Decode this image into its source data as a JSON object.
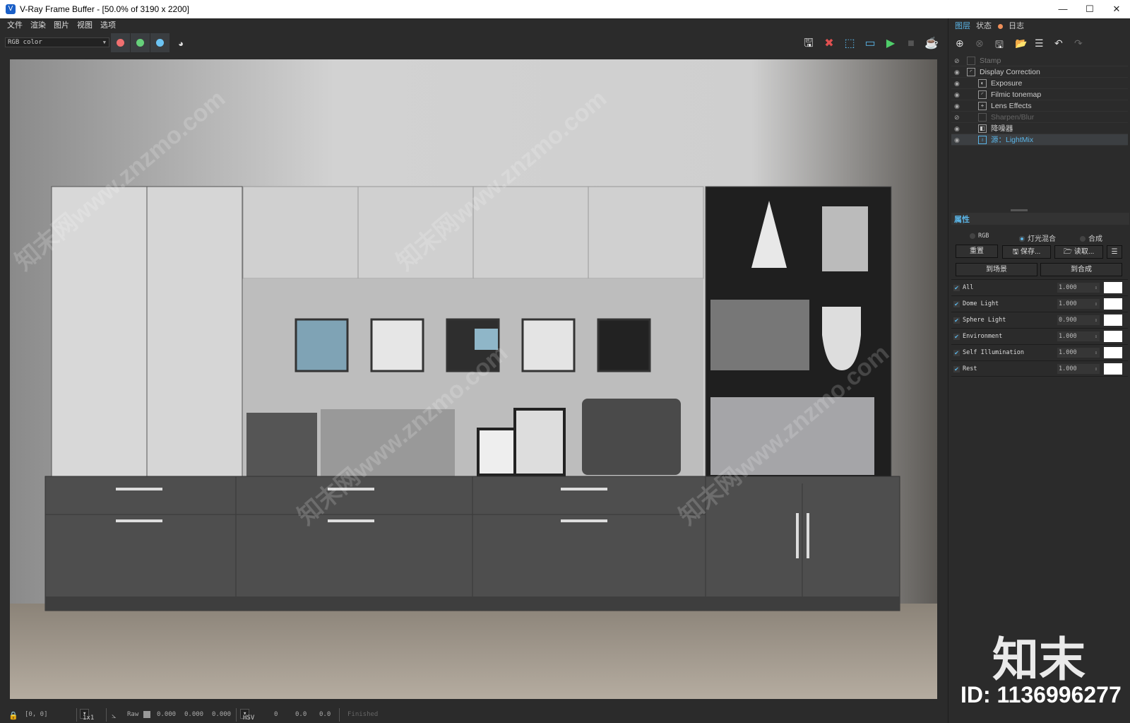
{
  "window": {
    "title": "V-Ray Frame Buffer - [50.0% of 3190 x 2200]",
    "controls": [
      "—",
      "☐",
      "✕"
    ]
  },
  "menu": [
    "文件",
    "渲染",
    "图片",
    "视图",
    "选项"
  ],
  "toolbar": {
    "channel": "RGB color",
    "channel_colors": {
      "red": "#f07070",
      "green": "#66d07a",
      "blue": "#6cc4f4"
    },
    "icons": [
      "save-icon",
      "clear-icon",
      "region-render-icon",
      "track-mouse-icon",
      "start-render-icon",
      "stop-render-icon",
      "render-icon"
    ]
  },
  "panel": {
    "tabs": [
      "图层",
      "状态",
      "日志"
    ],
    "log_dot_color": "#f0905a",
    "layers": [
      {
        "label": "Stamp",
        "visible": false
      },
      {
        "label": "Display Correction",
        "visible": true
      },
      {
        "label": "Exposure",
        "visible": true
      },
      {
        "label": "Filmic tonemap",
        "visible": true
      },
      {
        "label": "Lens Effects",
        "visible": true
      },
      {
        "label": "Sharpen/Blur",
        "visible": false
      },
      {
        "label": "降噪器",
        "visible": true
      },
      {
        "label": "源：LightMix",
        "visible": true,
        "selected": true
      }
    ],
    "properties_title": "属性",
    "modes": [
      "RGB",
      "灯光混合",
      "合成"
    ],
    "mode_selected": "灯光混合",
    "buttons": {
      "reset": "重置",
      "save": "保存...",
      "load": "读取...",
      "to_scene": "到场景",
      "to_composite": "到合成"
    },
    "lights": [
      {
        "name": "All",
        "value": "1.000"
      },
      {
        "name": "Dome Light",
        "value": "1.000"
      },
      {
        "name": "Sphere Light",
        "value": "0.900"
      },
      {
        "name": "Environment",
        "value": "1.000"
      },
      {
        "name": "Self Illumination",
        "value": "1.000"
      },
      {
        "name": "Rest",
        "value": "1.000"
      }
    ]
  },
  "status": {
    "coords": "[0, 0]",
    "sample": "1x1",
    "mode": "Raw",
    "r": "0.000",
    "g": "0.000",
    "b": "0.000",
    "space": "HSV",
    "h": "0",
    "s": "0.0",
    "v": "0.0",
    "state": "Finished"
  },
  "watermark": {
    "logo": "知末",
    "id": "ID: 1136996277",
    "diag": "知末网www.znzmo.com"
  }
}
